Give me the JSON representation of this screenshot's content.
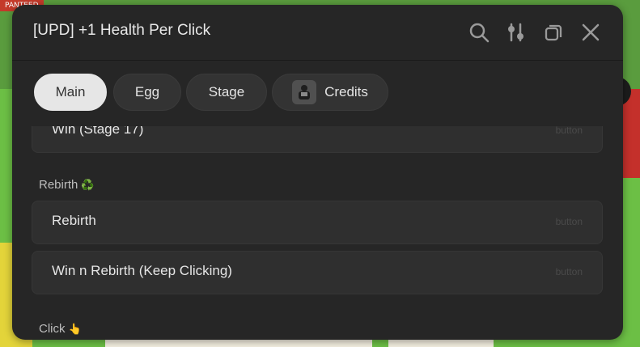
{
  "background": {
    "tag_text": "PANTEED"
  },
  "window": {
    "title": "[UPD] +1 Health Per Click",
    "icons": [
      "search-icon",
      "settings-sliders-icon",
      "copy-window-icon",
      "close-icon"
    ]
  },
  "tabs": [
    {
      "label": "Main",
      "active": true
    },
    {
      "label": "Egg",
      "active": false
    },
    {
      "label": "Stage",
      "active": false
    },
    {
      "label": "Credits",
      "active": false,
      "icon": "avatar-icon"
    }
  ],
  "rows": [
    {
      "label": "Win (Stage 17)",
      "kind": "button"
    },
    {
      "label": "Rebirth",
      "kind": "button"
    },
    {
      "label": "Win n Rebirth (Keep Clicking)",
      "kind": "button"
    }
  ],
  "sections": [
    {
      "label": "Rebirth",
      "emoji": "♻️"
    },
    {
      "label": "Click",
      "emoji": "👆"
    }
  ],
  "colors": {
    "panel": "#262626",
    "row": "#2f2f2f",
    "active_tab": "#e6e6e6"
  }
}
